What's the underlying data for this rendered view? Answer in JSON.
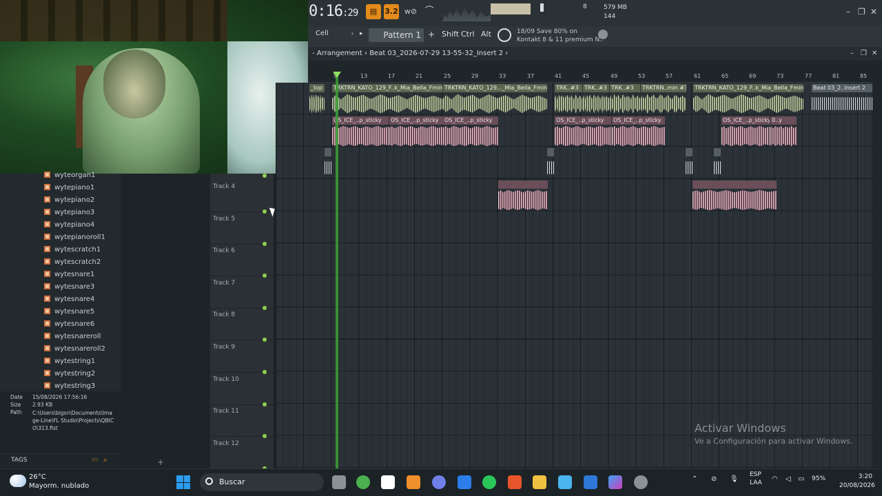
{
  "toolbar": {
    "time_main": "0:16",
    "time_sub": ":29",
    "tempo_label": "3.2",
    "cpu_polyphony": "8",
    "memory": "579 MB",
    "polyphony": "144"
  },
  "bar2": {
    "snap": "Cell",
    "pattern": "Pattern 1",
    "add": "+",
    "shift": "Shift",
    "ctrl": "Ctrl",
    "alt": "Alt",
    "news_line1": "18/09  Save 80% on",
    "news_line2": "Kontakt 8 & 11 premium N.."
  },
  "arrangement": {
    "title": "Arrangement",
    "separator": "›",
    "path": "Beat 03_2026-07-29 13-55-32_Insert 2"
  },
  "ruler": [
    "9",
    "13",
    "17",
    "21",
    "25",
    "29",
    "33",
    "37",
    "41",
    "45",
    "49",
    "53",
    "57",
    "61",
    "65",
    "69",
    "73",
    "77",
    "81",
    "85"
  ],
  "browser": {
    "items": [
      "wyteorgan1",
      "wytepiano1",
      "wytepiano2",
      "wytepiano3",
      "wytepiano4",
      "wytepianoroll1",
      "wytescratch1",
      "wytescratch2",
      "wytesnare1",
      "wytesnare3",
      "wytesnare4",
      "wytesnare5",
      "wytesnare6",
      "wytesnareroll",
      "wytesnareroll2",
      "wytestring1",
      "wytestring2",
      "wytestring3"
    ],
    "info": {
      "date_label": "Date",
      "date": "15/08/2026 17:56:16",
      "size_label": "Size",
      "size": "2.93 KB",
      "path_label": "Path",
      "path": "C:\\Users\\bigsn\\Documents\\Image-Line\\FL Studio\\Projects\\QBICO\\313.flst"
    },
    "tags_label": "TAGS"
  },
  "tracks": [
    "Track 4",
    "Track 5",
    "Track 6",
    "Track 7",
    "Track 8",
    "Track 9",
    "Track 10",
    "Track 11",
    "Track 12"
  ],
  "clips": {
    "row1": [
      "_top",
      "TRKTRN_KATO_129_F..k_Mia_Bella_Fmin",
      "TRKTRN_KATO_129..._Mia_Bella_Fmin",
      "TRK..#3",
      "TRK..#3",
      "TRK..#3",
      "TRKTRN..min #3",
      "TRKTRN_KATO_129_F..k_Mia_Bella_Fmin",
      "Beat 03_2..Insert 2"
    ],
    "row2": [
      "OS_ICE_..p_sticky",
      "OS_ICE_..p_sticky",
      "OS_ICE_..p_sticky",
      "OS_ICE_..p_sticky",
      "OS_ICE_..p_sticky",
      "OS_ICE_..p_sticky",
      "0..y"
    ]
  },
  "watermark": {
    "title": "Activar Windows",
    "subtitle": "Ve a Configuración para activar Windows."
  },
  "taskbar": {
    "temperature": "26°C",
    "weather": "Mayorm. nublado",
    "search": "Buscar",
    "lang1": "ESP",
    "lang2": "LAA",
    "battery": "95%",
    "time": "3:20",
    "date": "20/08/2026"
  },
  "colors": {
    "accent": "#e38a1c",
    "playhead": "#3aa035",
    "clip_green": "#5a6650",
    "clip_pink": "#6a4e58"
  }
}
